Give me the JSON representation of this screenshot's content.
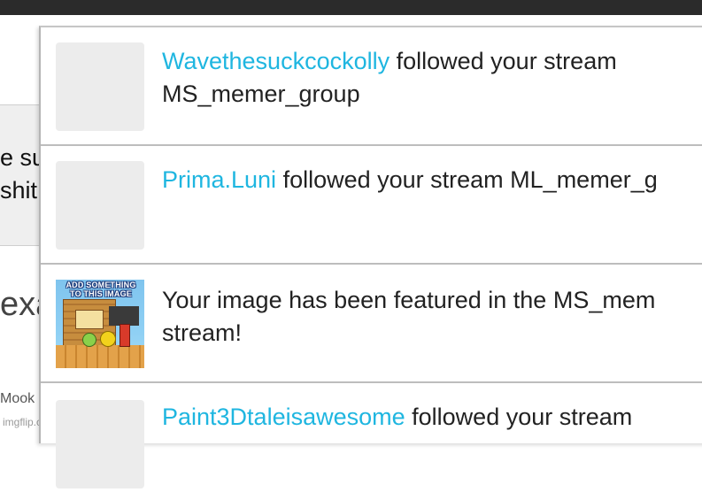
{
  "background": {
    "line1": "e su",
    "line2": "shit",
    "line3": "exa",
    "line4": "Mook"
  },
  "watermark": "imgflip.com",
  "notifications": [
    {
      "user": "Wavethesuckcockolly",
      "text_line1": " followed your stream",
      "text_line2": "MS_memer_group"
    },
    {
      "user": "Prima.Luni",
      "text_line1": " followed your stream ML_memer_g",
      "text_line2": ""
    },
    {
      "user": "",
      "text_line1": "Your image has been featured in the MS_mem",
      "text_line2": "stream!",
      "thumbnail_caption": "ADD SOMETHING TO THIS IMAGE"
    },
    {
      "user": "Paint3Dtaleisawesome",
      "text_line1": " followed your stream",
      "text_line2": ""
    }
  ],
  "colors": {
    "user_link": "#1fb6e0",
    "text": "#222222",
    "topbar": "#2b2b2b"
  }
}
